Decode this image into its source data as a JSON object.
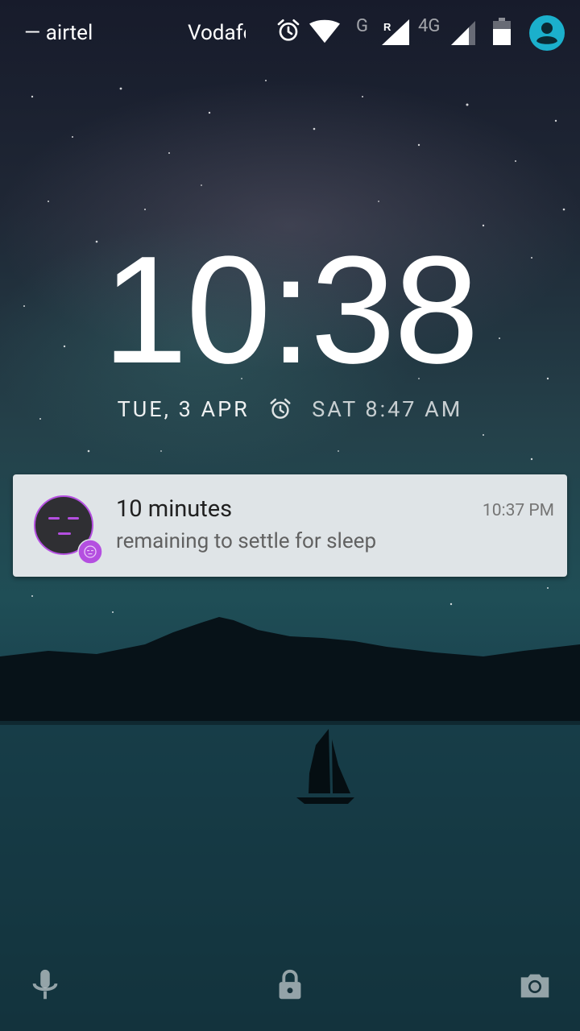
{
  "status_bar": {
    "carrier_1": "— airtel",
    "carrier_2": "Vodafone",
    "network_g": "G",
    "network_4g": "4G",
    "roaming_mark": "R",
    "icons": [
      "alarm-icon",
      "wifi-icon",
      "signal-roaming-icon",
      "signal-icon",
      "battery-icon",
      "user-avatar-icon"
    ]
  },
  "lockscreen": {
    "time": "10:38",
    "date": "TUE, 3 APR",
    "next_alarm": "SAT 8:47 AM"
  },
  "notification": {
    "title": "10 minutes",
    "text": "remaining to settle for sleep",
    "time": "10:37 PM",
    "icons": [
      "sleep-face-avatar",
      "app-badge-icon"
    ]
  },
  "bottom_bar": {
    "icons": [
      "microphone-icon",
      "lock-icon",
      "camera-icon"
    ]
  },
  "colors": {
    "notification_bg": "#dfe4e7",
    "accent_purple": "#b44fe0",
    "avatar_teal": "#1bb0cc"
  }
}
